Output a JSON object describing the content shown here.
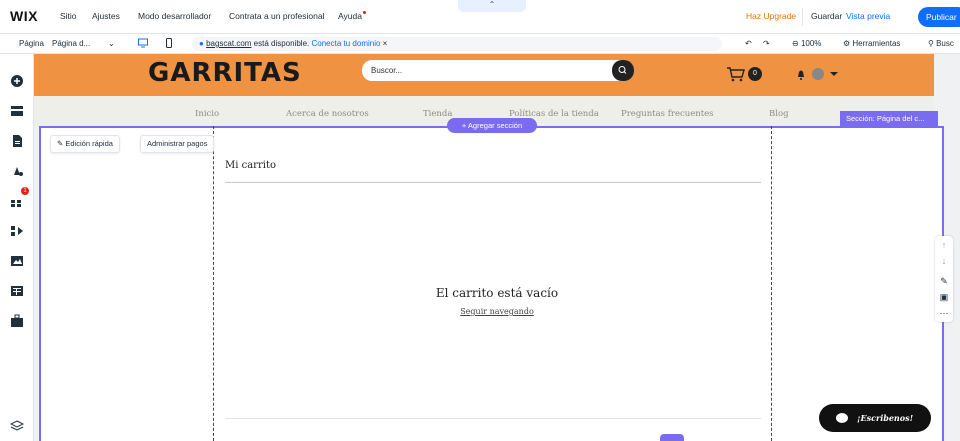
{
  "topbar": {
    "logo": "WIX",
    "menu": [
      "Sitio",
      "Ajustes",
      "Modo desarrollador",
      "Contrata a un profesional",
      "Ayuda"
    ],
    "upgrade": "Haz Upgrade",
    "save": "Guardar",
    "preview": "Vista previa",
    "publish": "Publicar"
  },
  "secondbar": {
    "page_label": "Página",
    "page_value": "Página d...",
    "url_domain": "bagscat.com",
    "url_text": " está disponible.",
    "url_link": "Conecta tu dominio",
    "zoom": "100%",
    "tools": "Herramientas",
    "search": "Busc"
  },
  "site": {
    "brand": "GARRITAS",
    "search_placeholder": "Buscor...",
    "cart_count": "0",
    "nav": [
      "Inicio",
      "Acerca de nosotros",
      "Tienda",
      "Políticas de la tienda",
      "Preguntas frecuentes",
      "Blog"
    ]
  },
  "editor": {
    "add_section": "+ Agregar sección",
    "section_tag": "Sección: Página del c...",
    "quick_edit": "Edición rápida",
    "manage_payments": "Administrar pagos"
  },
  "cart": {
    "title": "Mi carrito",
    "empty": "El carrito está vacío",
    "continue": "Seguir navegando"
  },
  "chat": {
    "label": "¡Escribenos!"
  },
  "badges": {
    "apps_badge": "1"
  },
  "colors": {
    "accent": "#116dff",
    "header": "#ef9343",
    "section": "#7a6cf0",
    "upgrade": "#e8730c"
  }
}
